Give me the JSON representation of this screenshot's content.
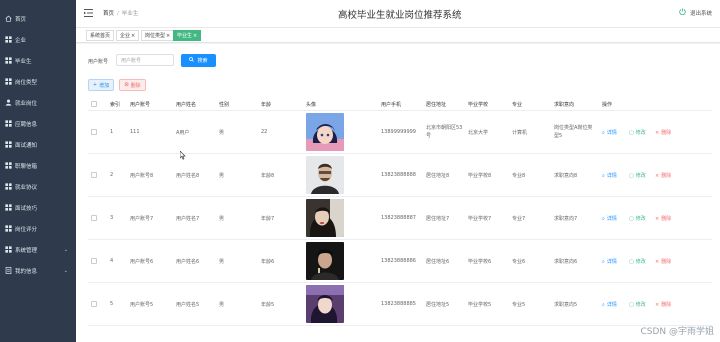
{
  "app": {
    "title": "高校毕业生就业岗位推荐系统",
    "logout_label": "退出系统"
  },
  "breadcrumb": {
    "home": "首页",
    "current": "毕业生"
  },
  "sidebar": {
    "items": [
      {
        "label": "首页",
        "icon": "home-icon"
      },
      {
        "label": "企业",
        "icon": "grid-icon"
      },
      {
        "label": "毕业生",
        "icon": "grid-icon"
      },
      {
        "label": "岗位类型",
        "icon": "grid-icon"
      },
      {
        "label": "就业岗位",
        "icon": "user-icon"
      },
      {
        "label": "应聘信息",
        "icon": "grid-icon"
      },
      {
        "label": "面试通知",
        "icon": "grid-icon"
      },
      {
        "label": "职聊信箱",
        "icon": "grid-icon"
      },
      {
        "label": "就业协议",
        "icon": "grid-icon"
      },
      {
        "label": "面试技巧",
        "icon": "grid-icon"
      },
      {
        "label": "岗位评分",
        "icon": "grid-icon"
      },
      {
        "label": "系统管理",
        "icon": "grid-icon",
        "chevron": true
      },
      {
        "label": "我的信息",
        "icon": "doc-icon",
        "chevron": true
      }
    ]
  },
  "tags": [
    {
      "label": "系统首页",
      "closable": false
    },
    {
      "label": "企业",
      "closable": true
    },
    {
      "label": "岗位类型",
      "closable": true
    },
    {
      "label": "毕业生",
      "closable": true,
      "active": true
    }
  ],
  "search": {
    "label": "用户账号",
    "placeholder": "用户账号",
    "button": "搜索"
  },
  "toolbar": {
    "add": "增加",
    "delete": "删除"
  },
  "table": {
    "headers": [
      "索引",
      "用户账号",
      "用户姓名",
      "性别",
      "年龄",
      "头像",
      "用户手机",
      "居住地址",
      "毕业学校",
      "专业",
      "求职意向",
      "操作"
    ],
    "actions": {
      "detail": "详情",
      "edit": "修改",
      "delete": "删除"
    },
    "rows": [
      {
        "index": "1",
        "account": "111",
        "name": "A用户",
        "gender": "男",
        "age": "22",
        "phone": "13899999999",
        "address": "北京市朝阳区53号",
        "school": "北京大学",
        "major": "计算机",
        "intent": "岗位类型A岗位类型5"
      },
      {
        "index": "2",
        "account": "用户账号8",
        "name": "用户姓名8",
        "gender": "男",
        "age": "年龄8",
        "phone": "13823888888",
        "address": "居住地址8",
        "school": "毕业学校8",
        "major": "专业8",
        "intent": "求职意向8"
      },
      {
        "index": "3",
        "account": "用户账号7",
        "name": "用户姓名7",
        "gender": "男",
        "age": "年龄7",
        "phone": "13823888887",
        "address": "居住地址7",
        "school": "毕业学校7",
        "major": "专业7",
        "intent": "求职意向7"
      },
      {
        "index": "4",
        "account": "用户账号6",
        "name": "用户姓名6",
        "gender": "男",
        "age": "年龄6",
        "phone": "13823888886",
        "address": "居住地址6",
        "school": "毕业学校6",
        "major": "专业6",
        "intent": "求职意向6"
      },
      {
        "index": "5",
        "account": "用户账号5",
        "name": "用户姓名5",
        "gender": "男",
        "age": "年龄5",
        "phone": "13823888885",
        "address": "居住地址5",
        "school": "毕业学校5",
        "major": "专业5",
        "intent": "求职意向5"
      }
    ]
  },
  "watermark": "CSDN @宇雨学姐",
  "colors": {
    "sidebar": "#2f3b4c",
    "primary": "#1890ff",
    "success": "#42b983",
    "danger": "#f56c6c"
  }
}
